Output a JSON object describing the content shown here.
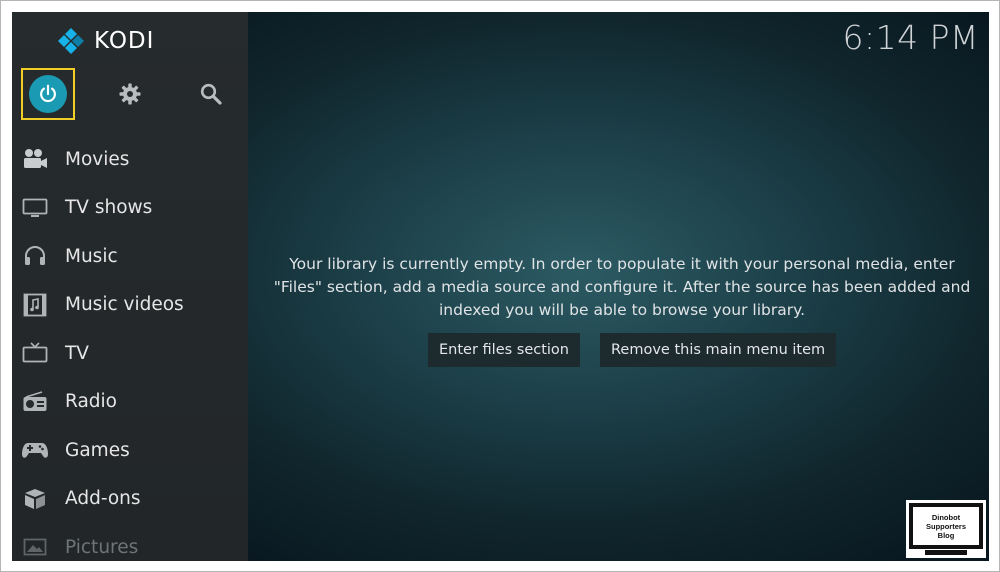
{
  "app": {
    "name": "KODI",
    "clock": "6:14 PM"
  },
  "top_icons": {
    "power": "power-icon",
    "settings": "gear-icon",
    "search": "search-icon"
  },
  "menu": [
    {
      "label": "Movies",
      "icon": "movie-camera-icon"
    },
    {
      "label": "TV shows",
      "icon": "monitor-icon"
    },
    {
      "label": "Music",
      "icon": "headphones-icon"
    },
    {
      "label": "Music videos",
      "icon": "music-video-icon"
    },
    {
      "label": "TV",
      "icon": "tv-icon"
    },
    {
      "label": "Radio",
      "icon": "radio-icon"
    },
    {
      "label": "Games",
      "icon": "gamepad-icon"
    },
    {
      "label": "Add-ons",
      "icon": "box-icon"
    },
    {
      "label": "Pictures",
      "icon": "picture-icon"
    }
  ],
  "main": {
    "message_line1": "Your library is currently empty. In order to populate it with your personal media, enter",
    "message_line2": "\"Files\" section, add a media source and configure it. After the source has been added and",
    "message_line3": "indexed you will be able to browse your library.",
    "enter_files_label": "Enter files section",
    "remove_item_label": "Remove this main menu item"
  },
  "watermark": {
    "line1": "Dinobot",
    "line2": "Supporters",
    "line3": "Blog"
  },
  "colors": {
    "accent": "#1a9bb3",
    "focus_border": "#f2cf26"
  }
}
